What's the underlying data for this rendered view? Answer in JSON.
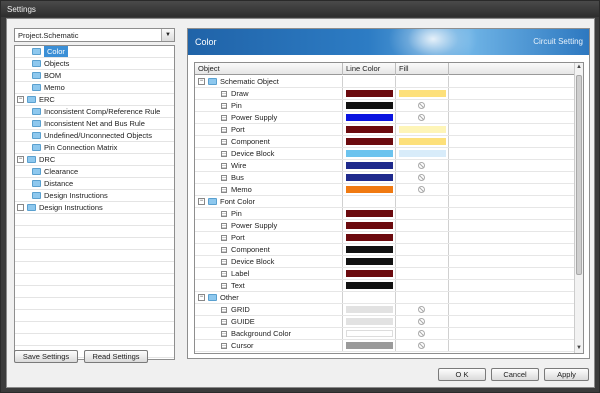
{
  "window": {
    "title": "Settings"
  },
  "project_select": {
    "value": "Project.Schematic"
  },
  "tree": [
    {
      "label": "Color",
      "level": 1,
      "expander": "",
      "selected": true
    },
    {
      "label": "Objects",
      "level": 1,
      "expander": ""
    },
    {
      "label": "BOM",
      "level": 1,
      "expander": ""
    },
    {
      "label": "Memo",
      "level": 1,
      "expander": ""
    },
    {
      "label": "ERC",
      "level": 0,
      "expander": "−"
    },
    {
      "label": "Inconsistent Comp/Reference Rule",
      "level": 1,
      "expander": ""
    },
    {
      "label": "Inconsistent Net and Bus Rule",
      "level": 1,
      "expander": ""
    },
    {
      "label": "Undefined/Unconnected Objects",
      "level": 1,
      "expander": ""
    },
    {
      "label": "Pin Connection Matrix",
      "level": 1,
      "expander": ""
    },
    {
      "label": "DRC",
      "level": 0,
      "expander": "−"
    },
    {
      "label": "Clearance",
      "level": 1,
      "expander": ""
    },
    {
      "label": "Distance",
      "level": 1,
      "expander": ""
    },
    {
      "label": "Design Instructions",
      "level": 1,
      "expander": ""
    },
    {
      "label": "Design Instructions",
      "level": 0,
      "expander": ""
    }
  ],
  "buttons": {
    "save_settings": "Save Settings",
    "read_settings": "Read Settings",
    "ok": "O K",
    "cancel": "Cancel",
    "apply": "Apply"
  },
  "banner": {
    "title": "Color",
    "subtitle": "Circuit Setting"
  },
  "grid": {
    "columns": [
      "Object",
      "Line Color",
      "Fill"
    ],
    "rows": [
      {
        "type": "group",
        "label": "Schematic Object"
      },
      {
        "type": "item",
        "label": "Draw",
        "line": "#6b0a0e",
        "fill": "#fde07a"
      },
      {
        "type": "item",
        "label": "Pin",
        "line": "#111111",
        "fill": null
      },
      {
        "type": "item",
        "label": "Power Supply",
        "line": "#0a14e0",
        "fill": null
      },
      {
        "type": "item",
        "label": "Port",
        "line": "#6b0a0e",
        "fill": "#fef5b8"
      },
      {
        "type": "item",
        "label": "Component",
        "line": "#6b0a0e",
        "fill": "#fde07a"
      },
      {
        "type": "item",
        "label": "Device Block",
        "line": "#6cc3ee",
        "fill": "#d8ecfa"
      },
      {
        "type": "item",
        "label": "Wire",
        "line": "#1f2a8c",
        "fill": null
      },
      {
        "type": "item",
        "label": "Bus",
        "line": "#1f2a8c",
        "fill": null
      },
      {
        "type": "item",
        "label": "Memo",
        "line": "#f07a12",
        "fill": null
      },
      {
        "type": "group",
        "label": "Font Color"
      },
      {
        "type": "item",
        "label": "Pin",
        "line": "#6b0a0e",
        "fill": ""
      },
      {
        "type": "item",
        "label": "Power Supply",
        "line": "#6b0a0e",
        "fill": ""
      },
      {
        "type": "item",
        "label": "Port",
        "line": "#6b0a0e",
        "fill": ""
      },
      {
        "type": "item",
        "label": "Component",
        "line": "#111111",
        "fill": ""
      },
      {
        "type": "item",
        "label": "Device Block",
        "line": "#111111",
        "fill": ""
      },
      {
        "type": "item",
        "label": "Label",
        "line": "#6b0a0e",
        "fill": ""
      },
      {
        "type": "item",
        "label": "Text",
        "line": "#111111",
        "fill": ""
      },
      {
        "type": "group",
        "label": "Other"
      },
      {
        "type": "item",
        "label": "GRID",
        "line": "#e2e2e2",
        "fill": null
      },
      {
        "type": "item",
        "label": "GUIDE",
        "line": "#e2e2e2",
        "fill": null
      },
      {
        "type": "item",
        "label": "Background Color",
        "line": "#ffffff",
        "fill": null
      },
      {
        "type": "item",
        "label": "Cursor",
        "line": "#9a9a9a",
        "fill": null
      }
    ]
  }
}
